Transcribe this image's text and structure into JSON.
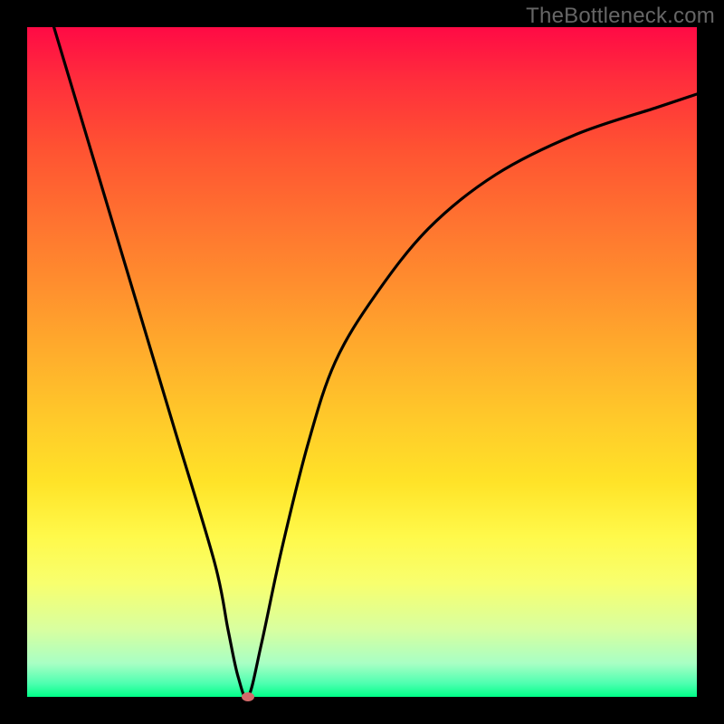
{
  "watermark": "TheBottleneck.com",
  "colors": {
    "page_bg": "#000000",
    "gradient_top": "#ff0a45",
    "gradient_bottom": "#00ff88",
    "curve": "#000000",
    "marker": "#d46a6a",
    "watermark_text": "#666666"
  },
  "chart_data": {
    "type": "line",
    "title": "",
    "xlabel": "",
    "ylabel": "",
    "xlim": [
      0,
      100
    ],
    "ylim": [
      0,
      100
    ],
    "grid": false,
    "legend": false,
    "series": [
      {
        "name": "bottleneck-curve",
        "x": [
          4,
          10,
          16,
          22,
          28,
          30,
          31.5,
          33,
          35,
          38,
          42,
          46,
          52,
          60,
          70,
          82,
          94,
          100
        ],
        "y": [
          100,
          80,
          60,
          40,
          20,
          10,
          3,
          0,
          8,
          22,
          38,
          50,
          60,
          70,
          78,
          84,
          88,
          90
        ]
      }
    ],
    "marker": {
      "x": 33,
      "y": 0
    },
    "annotations": []
  }
}
